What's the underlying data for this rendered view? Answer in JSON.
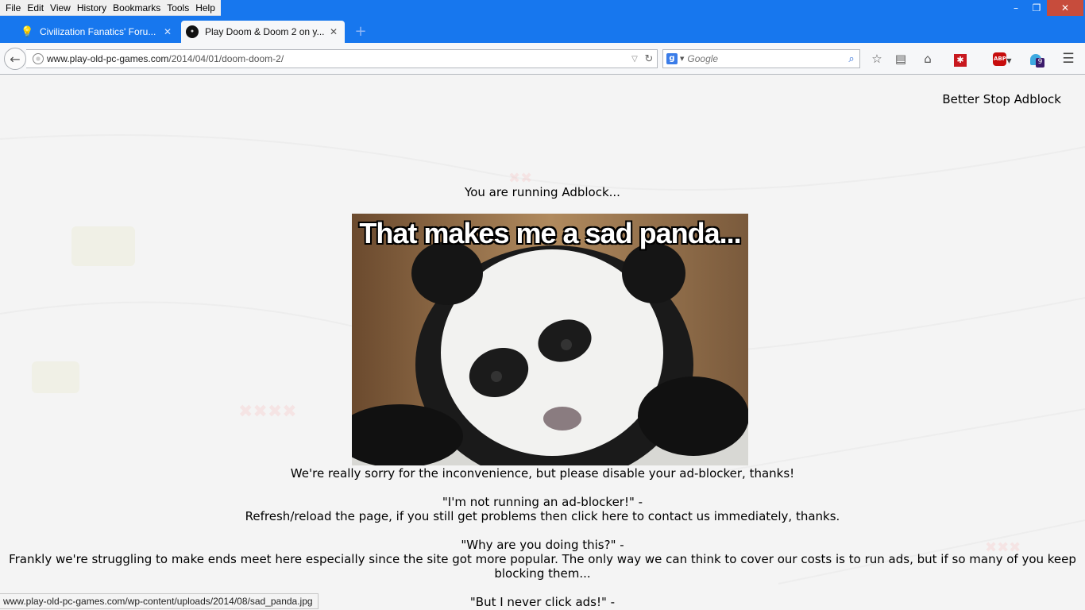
{
  "menu": {
    "items": [
      {
        "label": "File"
      },
      {
        "label": "Edit"
      },
      {
        "label": "View"
      },
      {
        "label": "History"
      },
      {
        "label": "Bookmarks"
      },
      {
        "label": "Tools"
      },
      {
        "label": "Help"
      }
    ]
  },
  "window_controls": {
    "minimize": "–",
    "maximize": "❐",
    "close": "✕"
  },
  "tabs": [
    {
      "title": "Civilization Fanatics' Foru...",
      "close": "✕"
    },
    {
      "title": "Play Doom & Doom 2 on y...",
      "close": "✕",
      "active": true
    }
  ],
  "new_tab": "+",
  "nav": {
    "back": "←",
    "url_domain": "www.play-old-pc-games.com",
    "url_path": "/2014/04/01/doom-doom-2/",
    "search_placeholder": "Google",
    "search_engine_letter": "g",
    "addon_badge": "9",
    "abp_label": "ABP"
  },
  "page": {
    "corner_heading": "Better Stop Adblock",
    "running": "You are running Adblock...",
    "image_caption": "That makes me a sad panda...",
    "sorry": "We're really sorry for the inconvenience, but please disable your ad-blocker, thanks!",
    "q1": "\"I'm not running an ad-blocker!\" -",
    "q1_answer": "Refresh/reload the page, if you still get problems then click here to contact us immediately, thanks.",
    "q2": "\"Why are you doing this?\" -",
    "q2_answer": "Frankly we're struggling to make ends meet here especially since the site got more popular. The only way we can think to cover our costs is to run ads, but if so many of you keep blocking them...",
    "q3": "\"But I never click ads!\" -"
  },
  "status": {
    "link_url": "www.play-old-pc-games.com/wp-content/uploads/2014/08/sad_panda.jpg"
  },
  "colors": {
    "titlebar": "#1777ee",
    "close_button": "#c74c3c",
    "page_bg": "#f5f5f5"
  }
}
